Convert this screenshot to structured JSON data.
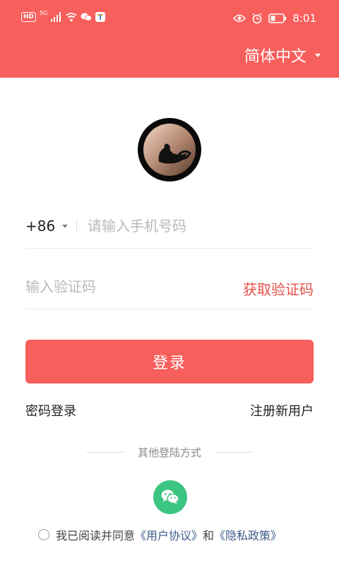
{
  "status_bar": {
    "hd": "HD",
    "network": "5G",
    "time": "8:01"
  },
  "header": {
    "language": "简体中文"
  },
  "login": {
    "country_code": "+86",
    "phone_placeholder": "请输入手机号码",
    "code_placeholder": "输入验证码",
    "get_code": "获取验证码",
    "login_button": "登录",
    "password_login": "密码登录",
    "register": "注册新用户",
    "other_methods": "其他登陆方式"
  },
  "agreement": {
    "prefix": "我已阅读并同意",
    "user_agreement": "《用户协议》",
    "and": "和",
    "privacy_policy": "《隐私政策》"
  },
  "colors": {
    "brand": "#F75F5C",
    "link": "#E5504C",
    "wechat": "#3CC481",
    "agreement_link": "#3E5B8A"
  }
}
